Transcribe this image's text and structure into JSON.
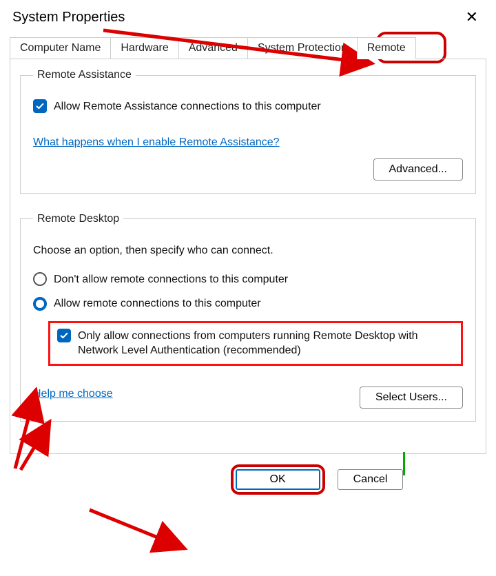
{
  "title": "System Properties",
  "tabs": [
    "Computer Name",
    "Hardware",
    "Advanced",
    "System Protection",
    "Remote"
  ],
  "active_tab_index": 4,
  "remote_assistance": {
    "legend": "Remote Assistance",
    "checkbox_label": "Allow Remote Assistance connections to this computer",
    "checkbox_checked": true,
    "link": "What happens when I enable Remote Assistance?",
    "advanced_button": "Advanced..."
  },
  "remote_desktop": {
    "legend": "Remote Desktop",
    "instruction": "Choose an option, then specify who can connect.",
    "option_deny": "Don't allow remote connections to this computer",
    "option_allow": "Allow remote connections to this computer",
    "selected_index": 1,
    "nla_label": "Only allow connections from computers running Remote Desktop with Network Level Authentication (recommended)",
    "nla_checked": true,
    "help_link": "Help me choose",
    "select_users_button": "Select Users..."
  },
  "buttons": {
    "ok": "OK",
    "cancel": "Cancel"
  },
  "annotation_color": "#c00"
}
